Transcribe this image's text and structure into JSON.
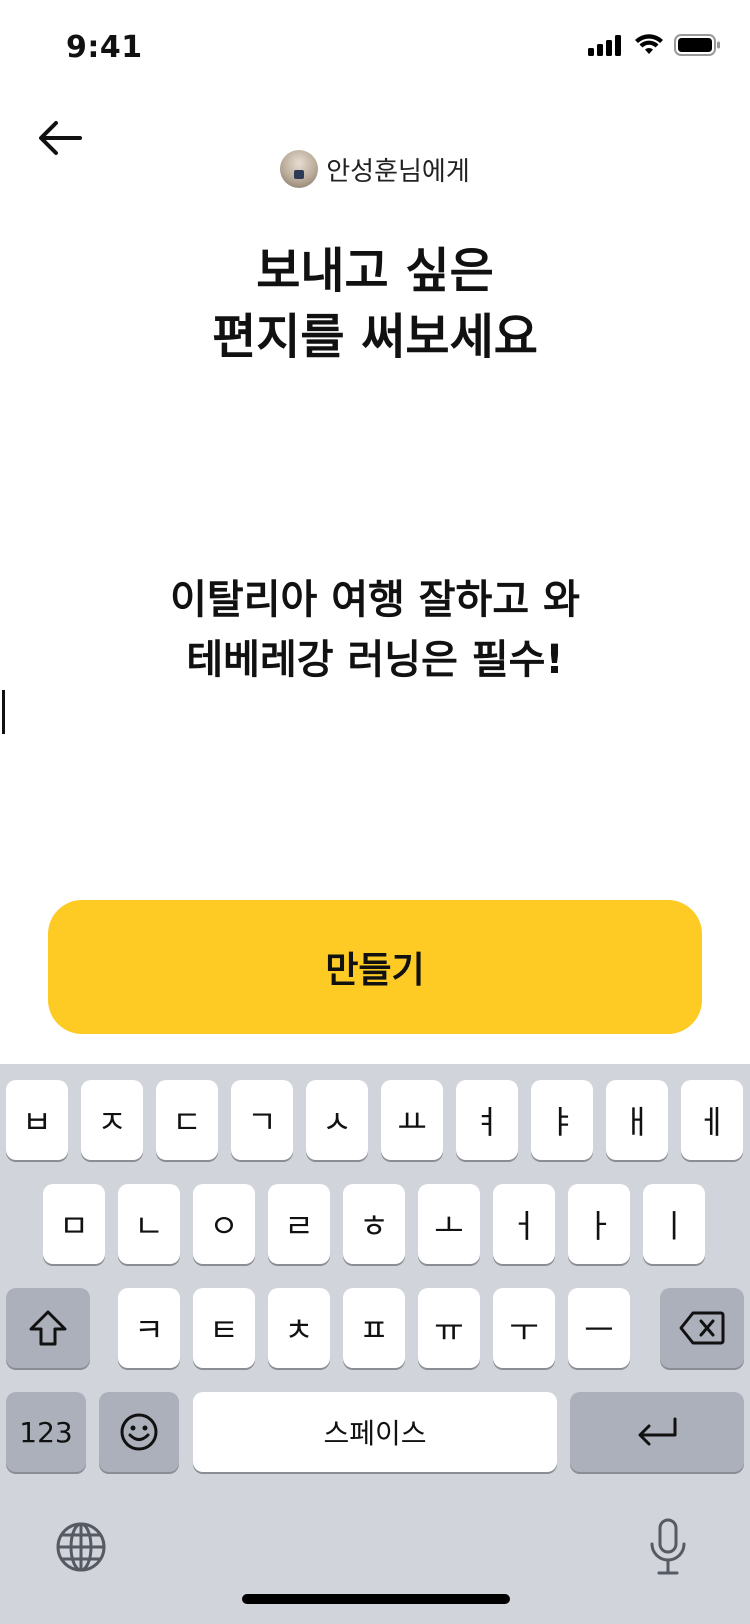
{
  "status": {
    "time": "9:41"
  },
  "recipient": {
    "label": "안성훈님에게"
  },
  "headline": {
    "line1": "보내고 싶은",
    "line2": "편지를 써보세요"
  },
  "letter": {
    "line1": "이탈리아 여행 잘하고 와",
    "line2": "테베레강 러닝은 필수!"
  },
  "cta": {
    "label": "만들기",
    "color": "#FDCB24"
  },
  "keyboard": {
    "row1": [
      "ㅂ",
      "ㅈ",
      "ㄷ",
      "ㄱ",
      "ㅅ",
      "ㅛ",
      "ㅕ",
      "ㅑ",
      "ㅐ",
      "ㅔ"
    ],
    "row2": [
      "ㅁ",
      "ㄴ",
      "ㅇ",
      "ㄹ",
      "ㅎ",
      "ㅗ",
      "ㅓ",
      "ㅏ",
      "ㅣ"
    ],
    "row3": [
      "ㅋ",
      "ㅌ",
      "ㅊ",
      "ㅍ",
      "ㅠ",
      "ㅜ",
      "ㅡ"
    ],
    "numbers_label": "123",
    "space_label": "스페이스",
    "shift_icon": "shift-icon",
    "delete_icon": "delete-icon",
    "emoji_icon": "emoji-icon",
    "return_icon": "return-icon",
    "globe_icon": "globe-icon",
    "mic_icon": "microphone-icon",
    "background": "#D1D4DB"
  }
}
